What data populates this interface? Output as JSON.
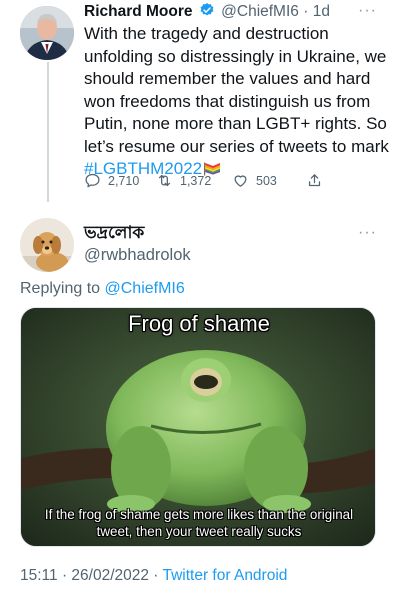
{
  "parent_tweet": {
    "author_name": "Richard Moore",
    "handle": "@ChiefMI6",
    "separator": "·",
    "time": "1d",
    "more": "···",
    "text_before": "With the tragedy and destruction unfolding so distressingly in Ukraine, we should remember the values and hard won freedoms that distinguish us from Putin, none more than LGBT+ rights. So let’s resume our series of tweets to mark ",
    "hashtag": "#LGBTHM2022",
    "reply_count": "2,710",
    "retweet_count": "1,372",
    "like_count": "503",
    "icons": [
      "verified-badge-icon",
      "rainbow-flag-icon",
      "reply-icon",
      "retweet-icon",
      "like-icon",
      "share-icon"
    ]
  },
  "reply_tweet": {
    "author_name": "ভদ্রলোক",
    "handle": "@rwbhadrolok",
    "more": "···",
    "replying_prefix": "Replying to ",
    "replying_to": "@ChiefMI6",
    "meme_top_text": "Frog of shame",
    "meme_bottom_text": "If the frog of shame gets more likes than the original tweet, then your tweet really sucks",
    "timestamp": "15:11 · 26/02/2022 · ",
    "source_app": "Twitter for Android"
  },
  "colors": {
    "link": "#1d9bf0",
    "secondary_text": "#536471",
    "primary_text": "#0f1419",
    "thread_line": "#cfd9de",
    "verified": "#1d9bf0"
  }
}
